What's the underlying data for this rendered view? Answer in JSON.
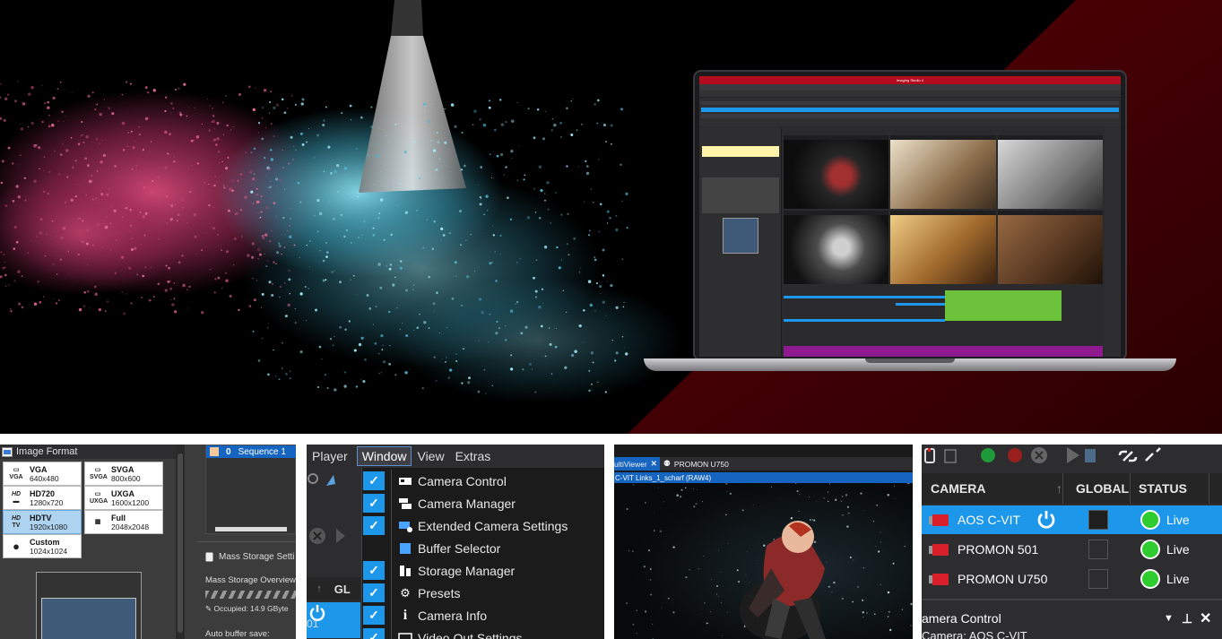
{
  "hero": {
    "app_title": "Imaging Studio 4"
  },
  "panel_image_format": {
    "header": "Image Format",
    "formats": [
      {
        "icon": "VGA",
        "name": "VGA",
        "res": "640x480",
        "selected": false
      },
      {
        "icon": "SVGA",
        "name": "SVGA",
        "res": "800x600",
        "selected": false
      },
      {
        "icon": "HD",
        "name": "HD720",
        "res": "1280x720",
        "selected": false
      },
      {
        "icon": "UXGA",
        "name": "UXGA",
        "res": "1600x1200",
        "selected": false
      },
      {
        "icon": "HD TV",
        "name": "HDTV",
        "res": "1920x1080",
        "selected": true
      },
      {
        "icon": "",
        "name": "Full",
        "res": "2048x2048",
        "selected": false
      },
      {
        "icon": "person",
        "name": "Custom",
        "res": "1024x1024",
        "selected": false
      }
    ],
    "sequence_number": "0",
    "sequence_label": "Sequence 1",
    "mass_storage_title": "Mass Storage Setti",
    "mass_storage_overview": "Mass Storage Overview",
    "occupied": "Occupied: 14.9 GByte",
    "auto_buffer": "Auto buffer save:"
  },
  "panel_window_menu": {
    "menubar": [
      "Player",
      "Window",
      "View",
      "Extras"
    ],
    "active_menu": "Window",
    "column_label": "GL",
    "row_text": "01",
    "items": [
      {
        "label": "Camera Control",
        "checked": true,
        "icon": "camera-control-icon"
      },
      {
        "label": "Camera Manager",
        "checked": true,
        "icon": "camera-manager-icon"
      },
      {
        "label": "Extended Camera Settings",
        "checked": true,
        "icon": "extended-settings-icon"
      },
      {
        "label": "Buffer Selector",
        "checked": false,
        "icon": "buffer-selector-icon"
      },
      {
        "label": "Storage Manager",
        "checked": true,
        "icon": "storage-manager-icon"
      },
      {
        "label": "Presets",
        "checked": true,
        "icon": "presets-icon"
      },
      {
        "label": "Camera Info",
        "checked": true,
        "icon": "info-icon"
      },
      {
        "label": "Video Out Settings",
        "checked": true,
        "icon": "video-out-icon"
      }
    ]
  },
  "panel_multiviewer": {
    "tab_active": "ultiViewer",
    "tab_other": "PROMON U750",
    "sub_title": "C-VIT Links_1_scharf (RAW4)"
  },
  "panel_camera_manager": {
    "columns": [
      "CAMERA",
      "GLOBAL",
      "STATUS"
    ],
    "cameras": [
      {
        "name": "AOS C-VIT",
        "status": "Live",
        "selected": true
      },
      {
        "name": "PROMON 501",
        "status": "Live",
        "selected": false
      },
      {
        "name": "PROMON U750",
        "status": "Live",
        "selected": false
      }
    ],
    "camera_control_title": "amera Control",
    "camera_line": "Camera:  AOS C-VIT",
    "colors": {
      "accent_blue": "#1c97ea",
      "live_green": "#2ecc2e",
      "brand_red": "#b10d1f"
    }
  }
}
